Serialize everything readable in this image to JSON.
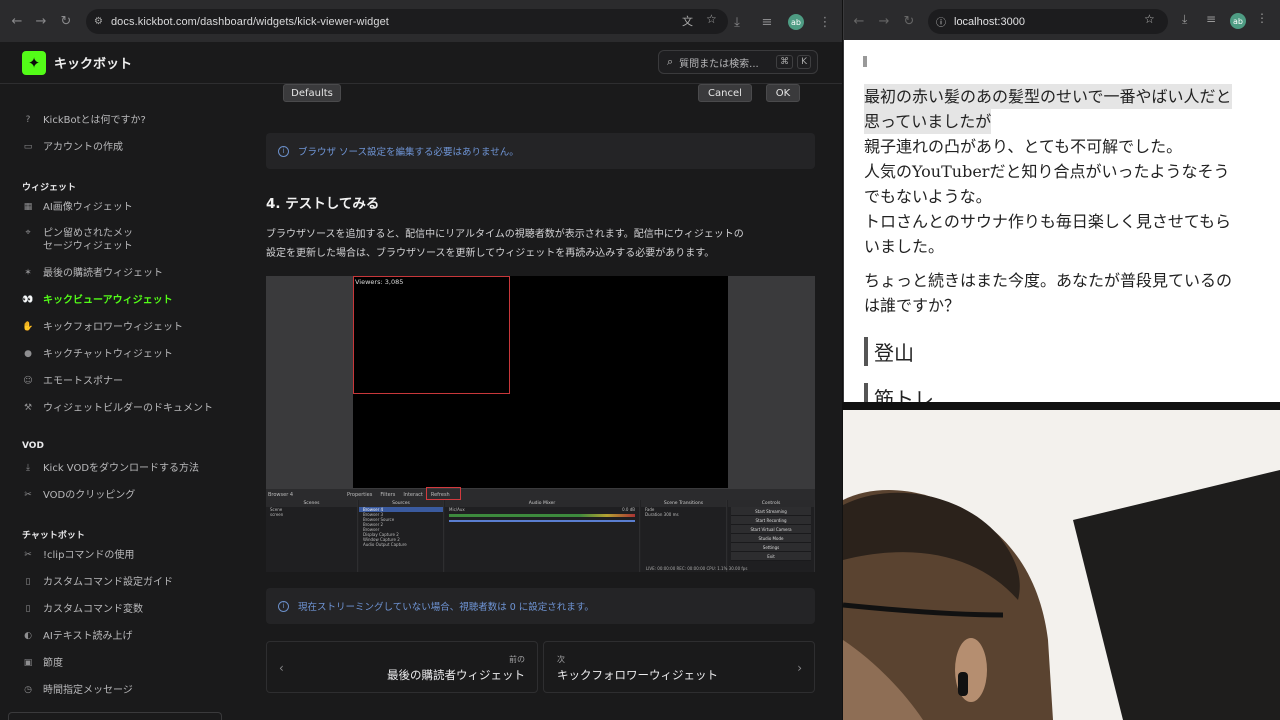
{
  "left_browser": {
    "url": "docs.kickbot.com/dashboard/widgets/kick-viewer-widget",
    "avatar": "ab"
  },
  "site": {
    "brand": "キックボット",
    "search_placeholder": "質問または検索...",
    "shortcut_keys": [
      "⌘",
      "K"
    ],
    "accent": "#53fc18"
  },
  "sidebar": {
    "items_top": [
      {
        "label": "KickBotとは何ですか?",
        "icon": "question-icon"
      },
      {
        "label": "アカウントの作成",
        "icon": "id-card-icon"
      }
    ],
    "sections": [
      {
        "title": "ウィジェット"
      },
      {
        "title": "VOD"
      },
      {
        "title": "チャットボット"
      }
    ],
    "widgets": [
      {
        "label": "AI画像ウィジェット",
        "icon": "image-icon"
      },
      {
        "label": "ピン留めされたメッ",
        "label2": "セージウィジェット",
        "icon": "pin-icon"
      },
      {
        "label": "最後の購読者ウィジェット",
        "icon": "star-icon"
      },
      {
        "label": "キックビューアウィジェット",
        "icon": "eyes-icon",
        "active": true
      },
      {
        "label": "キックフォロワーウィジェット",
        "icon": "wave-icon"
      },
      {
        "label": "キックチャットウィジェット",
        "icon": "chat-icon"
      },
      {
        "label": "エモートスポナー",
        "icon": "emote-icon"
      },
      {
        "label": "ウィジェットビルダーのドキュメント",
        "icon": "build-icon"
      }
    ],
    "vod": [
      {
        "label": "Kick VODをダウンロードする方法",
        "icon": "download-icon"
      },
      {
        "label": "VODのクリッピング",
        "icon": "clip-icon"
      }
    ],
    "chatbot": [
      {
        "label": "!clipコマンドの使用",
        "icon": "scissors-icon"
      },
      {
        "label": "カスタムコマンド設定ガイド",
        "icon": "doc-icon"
      },
      {
        "label": "カスタムコマンド変数",
        "icon": "doc-icon"
      },
      {
        "label": "AIテキスト読み上げ",
        "icon": "speaker-icon"
      },
      {
        "label": "節度",
        "icon": "shield-icon"
      },
      {
        "label": "時間指定メッセージ",
        "icon": "clock-icon"
      }
    ]
  },
  "main": {
    "dialog": {
      "defaults": "Defaults",
      "cancel": "Cancel",
      "ok": "OK"
    },
    "note1": "ブラウザ ソース設定を編集する必要はありません。",
    "heading": "4. テストしてみる",
    "paragraph_line1": "ブラウザソースを追加すると、配信中にリアルタイムの視聴者数が表示されます。配信中にウィジェットの",
    "paragraph_line2": "設定を更新した場合は、ブラウザソースを更新してウィジェットを再読み込みする必要があります。",
    "obs": {
      "viewers_text": "Viewers: 3,085",
      "source_name": "Browser 4",
      "toolbar": [
        "Properties",
        "Filters",
        "Interact",
        "Refresh"
      ],
      "docks": [
        "Scenes",
        "Sources",
        "Audio Mixer",
        "Scene Transitions",
        "Controls"
      ],
      "scenes": [
        "Scene",
        "screen"
      ],
      "sources": [
        "Browser 4",
        "Browser 3",
        "Browser Source",
        "Browser 2",
        "Browser",
        "Display Capture 2",
        "Window Capture 2",
        "Audio Output Capture"
      ],
      "mixer_track": "Mic/Aux",
      "mixer_db": "0.0 dB",
      "transition": "Fade",
      "duration_label": "Duration",
      "duration_value": "300 ms",
      "controls": [
        "Start Streaming",
        "Start Recording",
        "Start Virtual Camera",
        "Studio Mode",
        "Settings",
        "Exit"
      ],
      "status": "LIVE: 00:00:00    REC: 00:00:00    CPU: 1.1% 30.00 fps"
    },
    "note2": "現在ストリーミングしていない場合、視聴者数は 0 に設定されます。",
    "prev": {
      "small": "前の",
      "big": "最後の購読者ウィジェット"
    },
    "next": {
      "small": "次",
      "big": "キックフォロワーウィジェット"
    }
  },
  "right_browser": {
    "url": "localhost:3000",
    "avatar": "ab",
    "lines": [
      "最初の赤い髪のあの髪型のせいで一番やばい人だと",
      "思っていましたが",
      "親子連れの凸があり、とても不可解でした。",
      "人気のYouTuberだと知り合点がいったようなそう",
      "でもないような。",
      "トロさんとのサウナ作りも毎日楽しく見させてもら",
      "いました。",
      "ちょっと続きはまた今度。あなたが普段見ているの",
      "は誰ですか？"
    ],
    "heading1": "登山",
    "heading2_partial": "筋トレ"
  }
}
